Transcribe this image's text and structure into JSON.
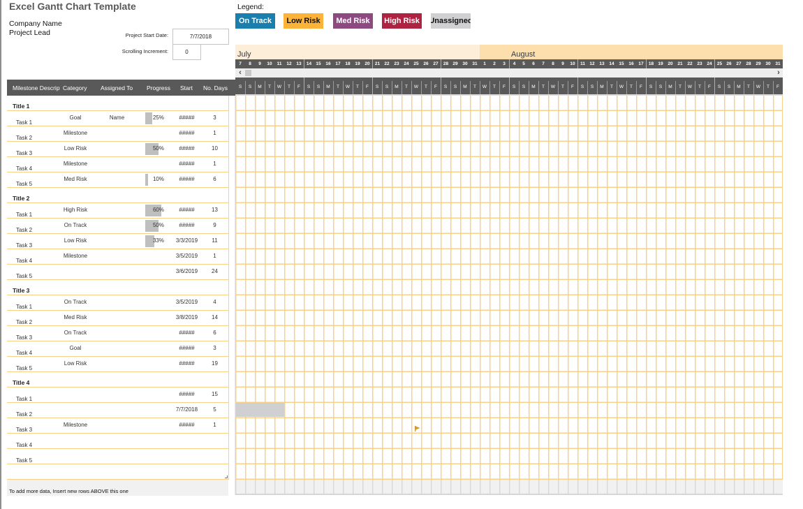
{
  "app": {
    "title": "Excel Gantt Chart Template",
    "company": "Company Name",
    "lead": "Project Lead"
  },
  "settings": {
    "start_label": "Project Start Date:",
    "start_value": "7/7/2018",
    "increment_label": "Scrolling Increment:",
    "increment_value": "0"
  },
  "legend": {
    "label": "Legend:",
    "items": [
      {
        "label": "On Track",
        "color": "#1a7fac",
        "text_color": "#ffffff"
      },
      {
        "label": "Low Risk",
        "color": "#fbb33a",
        "text_color": "#111111"
      },
      {
        "label": "Med Risk",
        "color": "#8d4a80",
        "text_color": "#ffffff"
      },
      {
        "label": "High Risk",
        "color": "#ae2342",
        "text_color": "#ffffff"
      },
      {
        "label": "Unassigned",
        "color": "#d0cfd1",
        "text_color": "#111111"
      }
    ]
  },
  "table": {
    "columns": {
      "description": "Milestone Description",
      "category": "Category",
      "assigned": "Assigned To",
      "progress": "Progress",
      "start": "Start",
      "days": "No. Days"
    },
    "rows": [
      {
        "type": "title",
        "label": "Title 1"
      },
      {
        "type": "task",
        "label": "Task 1",
        "category": "Goal",
        "assigned": "Name",
        "progress": 25,
        "progress_label": "25%",
        "start": "#####",
        "days": "3"
      },
      {
        "type": "task",
        "label": "Task 2",
        "category": "Milestone",
        "assigned": "",
        "progress": null,
        "progress_label": "",
        "start": "#####",
        "days": "1"
      },
      {
        "type": "task",
        "label": "Task 3",
        "category": "Low Risk",
        "assigned": "",
        "progress": 50,
        "progress_label": "50%",
        "start": "#####",
        "days": "10"
      },
      {
        "type": "task",
        "label": "Task 4",
        "category": "Milestone",
        "assigned": "",
        "progress": null,
        "progress_label": "",
        "start": "#####",
        "days": "1"
      },
      {
        "type": "task",
        "label": "Task 5",
        "category": "Med Risk",
        "assigned": "",
        "progress": 10,
        "progress_label": "10%",
        "start": "#####",
        "days": "6"
      },
      {
        "type": "title",
        "label": "Title 2"
      },
      {
        "type": "task",
        "label": "Task 1",
        "category": "High Risk",
        "assigned": "",
        "progress": 60,
        "progress_label": "60%",
        "start": "#####",
        "days": "13"
      },
      {
        "type": "task",
        "label": "Task 2",
        "category": "On Track",
        "assigned": "",
        "progress": 50,
        "progress_label": "50%",
        "start": "#####",
        "days": "9"
      },
      {
        "type": "task",
        "label": "Task 3",
        "category": "Low Risk",
        "assigned": "",
        "progress": 33,
        "progress_label": "33%",
        "start": "3/3/2019",
        "days": "11"
      },
      {
        "type": "task",
        "label": "Task 4",
        "category": "Milestone",
        "assigned": "",
        "progress": null,
        "progress_label": "",
        "start": "3/5/2019",
        "days": "1"
      },
      {
        "type": "task",
        "label": "Task 5",
        "category": "",
        "assigned": "",
        "progress": null,
        "progress_label": "",
        "start": "3/6/2019",
        "days": "24"
      },
      {
        "type": "title",
        "label": "Title 3"
      },
      {
        "type": "task",
        "label": "Task 1",
        "category": "On Track",
        "assigned": "",
        "progress": null,
        "progress_label": "",
        "start": "3/5/2019",
        "days": "4"
      },
      {
        "type": "task",
        "label": "Task 2",
        "category": "Med Risk",
        "assigned": "",
        "progress": null,
        "progress_label": "",
        "start": "3/8/2019",
        "days": "14"
      },
      {
        "type": "task",
        "label": "Task 3",
        "category": "On Track",
        "assigned": "",
        "progress": null,
        "progress_label": "",
        "start": "#####",
        "days": "6"
      },
      {
        "type": "task",
        "label": "Task 4",
        "category": "Goal",
        "assigned": "",
        "progress": null,
        "progress_label": "",
        "start": "#####",
        "days": "3"
      },
      {
        "type": "task",
        "label": "Task 5",
        "category": "Low Risk",
        "assigned": "",
        "progress": null,
        "progress_label": "",
        "start": "#####",
        "days": "19"
      },
      {
        "type": "title",
        "label": "Title 4"
      },
      {
        "type": "task",
        "label": "Task 1",
        "category": "",
        "assigned": "",
        "progress": null,
        "progress_label": "",
        "start": "#####",
        "days": "15"
      },
      {
        "type": "task",
        "label": "Task 2",
        "category": "",
        "assigned": "",
        "progress": null,
        "progress_label": "",
        "start": "7/7/2018",
        "days": "5"
      },
      {
        "type": "task",
        "label": "Task 3",
        "category": "Milestone",
        "assigned": "",
        "progress": null,
        "progress_label": "",
        "start": "#####",
        "days": "1",
        "milestone_date": "7/25/2018"
      },
      {
        "type": "task",
        "label": "Task 4",
        "category": "",
        "assigned": "",
        "progress": null,
        "progress_label": "",
        "start": "",
        "days": ""
      },
      {
        "type": "task",
        "label": "Task 5",
        "category": "",
        "assigned": "",
        "progress": null,
        "progress_label": "",
        "start": "",
        "days": ""
      }
    ],
    "footer_note": "To add more data, Insert new rows ABOVE this one"
  },
  "timeline": {
    "months": [
      {
        "name": "July",
        "days": 25,
        "color": "#fdeeda"
      },
      {
        "name": "August",
        "days": 31,
        "color": "#fddfad"
      }
    ],
    "day_numbers": [
      "7",
      "8",
      "9",
      "10",
      "11",
      "12",
      "13",
      "14",
      "15",
      "16",
      "17",
      "18",
      "19",
      "20",
      "21",
      "22",
      "23",
      "24",
      "25",
      "26",
      "27",
      "28",
      "29",
      "30",
      "31",
      "1",
      "2",
      "3",
      "4",
      "5",
      "6",
      "7",
      "8",
      "9",
      "10",
      "11",
      "12",
      "13",
      "14",
      "15",
      "16",
      "17",
      "18",
      "19",
      "20",
      "21",
      "22",
      "23",
      "24",
      "25",
      "26",
      "27",
      "28",
      "29",
      "30",
      "31"
    ],
    "day_letters": [
      "S",
      "S",
      "M",
      "T",
      "W",
      "T",
      "F",
      "S",
      "S",
      "M",
      "T",
      "W",
      "T",
      "F",
      "S",
      "S",
      "M",
      "T",
      "W",
      "T",
      "F",
      "S",
      "S",
      "M",
      "T",
      "W",
      "T",
      "F",
      "S",
      "S",
      "M",
      "T",
      "W",
      "T",
      "F",
      "S",
      "S",
      "M",
      "T",
      "W",
      "T",
      "F",
      "S",
      "S",
      "M",
      "T",
      "W",
      "T",
      "F",
      "S",
      "S",
      "M",
      "T",
      "W",
      "T",
      "F"
    ],
    "scroll_left": "‹",
    "scroll_right": "›"
  },
  "gantt": {
    "default_bar_color": "#d0cfd1",
    "milestone_color": "#d49a32"
  }
}
